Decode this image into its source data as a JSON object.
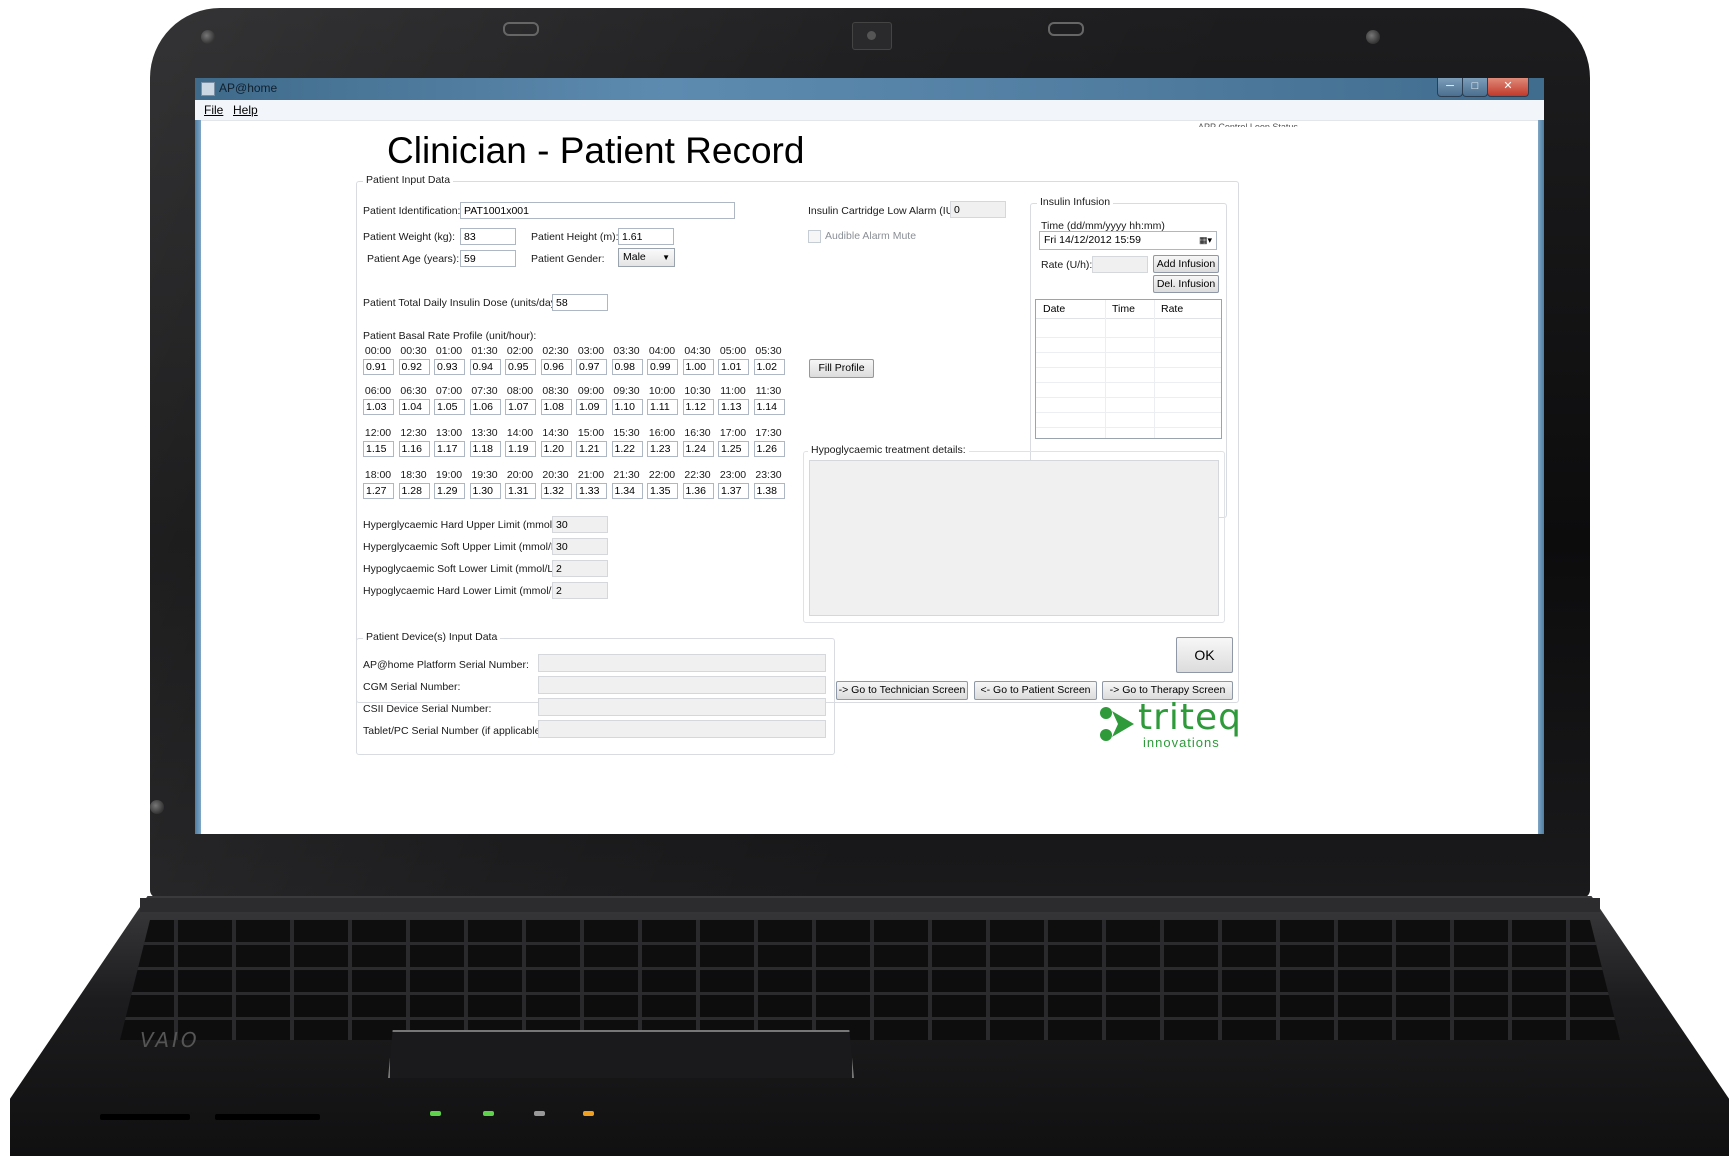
{
  "window": {
    "title": "AP@home",
    "controls": {
      "minimize": "─",
      "maximize": "□",
      "close": "✕"
    }
  },
  "menu": {
    "file": "File",
    "help": "Help"
  },
  "page": {
    "title": "Clinician - Patient Record",
    "status_header": "APP Control Loop Status"
  },
  "patient_input": {
    "group_title": "Patient Input Data",
    "id_label": "Patient Identification:",
    "id_value": "PAT1001x001",
    "weight_label": "Patient Weight (kg):",
    "weight_value": "83",
    "height_label": "Patient Height (m):",
    "height_value": "1.61",
    "age_label": "Patient Age (years):",
    "age_value": "59",
    "gender_label": "Patient Gender:",
    "gender_value": "Male",
    "tdd_label": "Patient Total Daily Insulin Dose (units/day):",
    "tdd_value": "58",
    "basal_label": "Patient Basal Rate Profile (unit/hour):",
    "fill_profile": "Fill Profile",
    "basal_rows": [
      {
        "times": [
          "00:00",
          "00:30",
          "01:00",
          "01:30",
          "02:00",
          "02:30",
          "03:00",
          "03:30",
          "04:00",
          "04:30",
          "05:00",
          "05:30"
        ],
        "rates": [
          "0.91",
          "0.92",
          "0.93",
          "0.94",
          "0.95",
          "0.96",
          "0.97",
          "0.98",
          "0.99",
          "1.00",
          "1.01",
          "1.02"
        ]
      },
      {
        "times": [
          "06:00",
          "06:30",
          "07:00",
          "07:30",
          "08:00",
          "08:30",
          "09:00",
          "09:30",
          "10:00",
          "10:30",
          "11:00",
          "11:30"
        ],
        "rates": [
          "1.03",
          "1.04",
          "1.05",
          "1.06",
          "1.07",
          "1.08",
          "1.09",
          "1.10",
          "1.11",
          "1.12",
          "1.13",
          "1.14"
        ]
      },
      {
        "times": [
          "12:00",
          "12:30",
          "13:00",
          "13:30",
          "14:00",
          "14:30",
          "15:00",
          "15:30",
          "16:00",
          "16:30",
          "17:00",
          "17:30"
        ],
        "rates": [
          "1.15",
          "1.16",
          "1.17",
          "1.18",
          "1.19",
          "1.20",
          "1.21",
          "1.22",
          "1.23",
          "1.24",
          "1.25",
          "1.26"
        ]
      },
      {
        "times": [
          "18:00",
          "18:30",
          "19:00",
          "19:30",
          "20:00",
          "20:30",
          "21:00",
          "21:30",
          "22:00",
          "22:30",
          "23:00",
          "23:30"
        ],
        "rates": [
          "1.27",
          "1.28",
          "1.29",
          "1.30",
          "1.31",
          "1.32",
          "1.33",
          "1.34",
          "1.35",
          "1.36",
          "1.37",
          "1.38"
        ]
      }
    ],
    "hyper_hard_label": "Hyperglycaemic Hard Upper Limit (mmol/L):",
    "hyper_hard_value": "30",
    "hyper_soft_label": "Hyperglycaemic Soft Upper Limit (mmol/L):",
    "hyper_soft_value": "30",
    "hypo_soft_label": "Hypoglycaemic Soft Lower Limit (mmol/L):",
    "hypo_soft_value": "2",
    "hypo_hard_label": "Hypoglycaemic Hard Lower Limit (mmol/L):",
    "hypo_hard_value": "2",
    "cartridge_label": "Insulin Cartridge Low Alarm (IU):",
    "cartridge_value": "0",
    "alarm_mute_label": "Audible Alarm Mute",
    "hypo_treatment_label": "Hypoglycaemic treatment details:"
  },
  "infusion": {
    "group_title": "Insulin Infusion",
    "time_label": "Time (dd/mm/yyyy hh:mm)",
    "time_value": "Fri   14/12/2012  15:59",
    "rate_label": "Rate (U/h):",
    "add_button": "Add Infusion",
    "del_button": "Del. Infusion",
    "columns": [
      "Date",
      "Time",
      "Rate"
    ]
  },
  "devices": {
    "group_title": "Patient Device(s) Input Data",
    "platform_label": "AP@home Platform Serial Number:",
    "cgm_label": "CGM Serial Number:",
    "csii_label": "CSII Device Serial Number:",
    "tablet_label": "Tablet/PC Serial Number (if applicable):"
  },
  "actions": {
    "ok": "OK",
    "technician": "-> Go to Technician Screen",
    "patient": "<- Go to Patient Screen",
    "therapy": "-> Go to Therapy Screen"
  },
  "logo": {
    "name": "triteq",
    "tagline": "innovations",
    "color": "#2e9a3a"
  },
  "laptop": {
    "brand": "VAIO"
  },
  "colors": {
    "accent_green": "#2e9a3a",
    "titlebar_blue": "#5d8bb0"
  }
}
